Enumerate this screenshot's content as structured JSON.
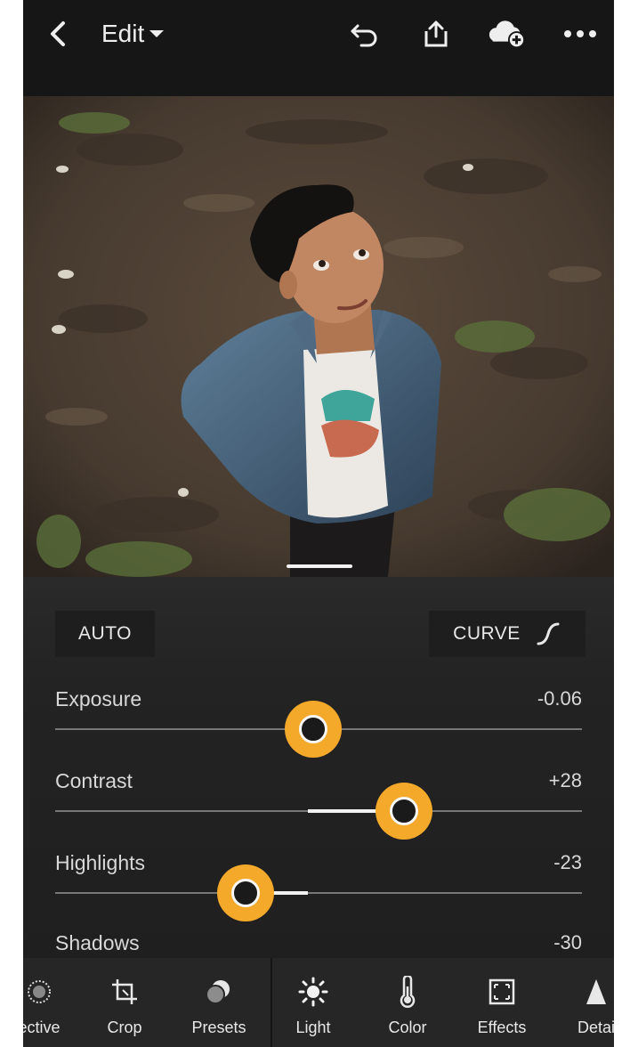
{
  "header": {
    "edit_label": "Edit",
    "icons": [
      "back-icon",
      "chevron-down-icon",
      "undo-icon",
      "share-icon",
      "cloud-add-icon",
      "more-icon"
    ]
  },
  "panel": {
    "auto_label": "AUTO",
    "curve_label": "CURVE",
    "sliders": [
      {
        "label": "Exposure",
        "value": "-0.06"
      },
      {
        "label": "Contrast",
        "value": "+28"
      },
      {
        "label": "Highlights",
        "value": "-23"
      },
      {
        "label": "Shadows",
        "value": "-30"
      }
    ]
  },
  "toolbar": {
    "items": [
      {
        "label": "ective",
        "icon": "selective-icon"
      },
      {
        "label": "Crop",
        "icon": "crop-icon"
      },
      {
        "label": "Presets",
        "icon": "presets-icon"
      },
      {
        "label": "Light",
        "icon": "sun-icon"
      },
      {
        "label": "Color",
        "icon": "thermometer-icon"
      },
      {
        "label": "Effects",
        "icon": "effects-icon"
      },
      {
        "label": "Detai",
        "icon": "detail-icon"
      }
    ]
  },
  "colors": {
    "accent": "#f4a92a",
    "background": "#1b1b1b"
  }
}
